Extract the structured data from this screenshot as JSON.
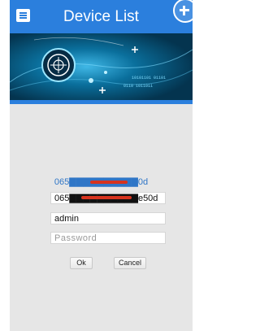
{
  "header": {
    "title": "Device List",
    "menu_icon": "list-icon",
    "add_icon": "add-device-icon"
  },
  "banner": {
    "image": "security-camera-lens-graphic"
  },
  "device": {
    "id_display": "065▇▇▇▇▇▇▇▇▇▇0d"
  },
  "form": {
    "device_id_value": "065▇▇▇▇▇▇▇▇▇▇e50d",
    "username_value": "admin",
    "password_placeholder": "Password",
    "ok_label": "Ok",
    "cancel_label": "Cancel"
  },
  "colors": {
    "accent": "#2b7fdd",
    "link": "#2f76c7",
    "background": "#e6e6e6",
    "redaction": "#d7331e"
  }
}
